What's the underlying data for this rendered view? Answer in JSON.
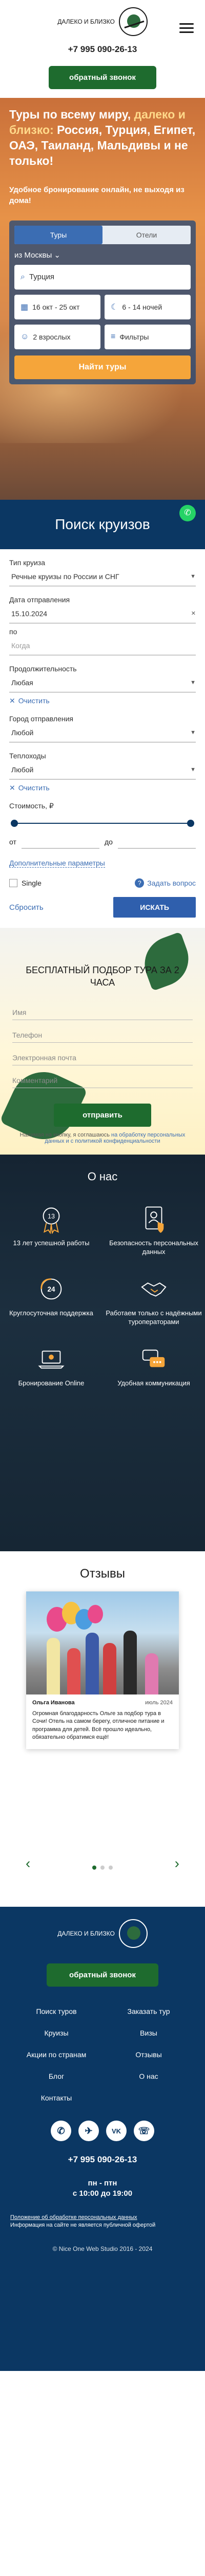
{
  "header": {
    "logo_text": "ДАЛЕКО И БЛИЗКО",
    "phone": "+7 995 090-26-13",
    "callback_btn": "обратный звонок"
  },
  "hero": {
    "title_a": "Туры по всему миру, ",
    "title_hi": "далеко и близко:",
    "title_b": " Россия, Турция, Египет, ОАЭ, Таиланд, Мальдивы и не только!",
    "subtitle": "Удобное бронирование онлайн, не выходя из дома!",
    "tabs": [
      "Туры",
      "Отели"
    ],
    "from_label": "из Москвы",
    "destination": "Турция",
    "dates": "16 окт - 25 окт",
    "nights": "6 - 14 ночей",
    "tourists": "2 взрослых",
    "filters": "Фильтры",
    "find_btn": "Найти туры"
  },
  "cruise": {
    "title": "Поиск круизов",
    "type_label": "Тип круиза",
    "type_value": "Речные круизы по России и СНГ",
    "date_label": "Дата отправления",
    "date_value": "15.10.2024",
    "to_label": "по",
    "to_placeholder": "Когда",
    "duration_label": "Продолжительность",
    "duration_value": "Любая",
    "clear": "Очистить",
    "city_label": "Город отправления",
    "city_value": "Любой",
    "ship_label": "Теплоходы",
    "ship_value": "Любой",
    "price_label": "Стоимость, ₽",
    "from": "от",
    "to": "до",
    "advanced": "Дополнительные параметры",
    "single": "Single",
    "help": "Задать вопрос",
    "reset": "Сбросить",
    "search_btn": "ИСКАТЬ"
  },
  "callback": {
    "title": "БЕСПЛАТНЫЙ ПОДБОР ТУРА ЗА 2 ЧАСА",
    "fields": [
      "Имя",
      "Телефон",
      "Электронная почта",
      "Комментарий"
    ],
    "send_btn": "отправить",
    "consent_a": "Нажимая на кнопку, я соглашаюсь ",
    "consent_link": "на обработку персональных данных и с политикой конфиденциальности"
  },
  "about": {
    "title": "О нас",
    "features": [
      {
        "text": "13 лет успешной работы",
        "icon": "ribbon-icon"
      },
      {
        "text": "Безопасность персональных данных",
        "icon": "shield-person-icon"
      },
      {
        "text": "Круглосуточная поддержка",
        "icon": "support-24-icon"
      },
      {
        "text": "Работаем только с надёжными туроператорами",
        "icon": "handshake-icon"
      },
      {
        "text": "Бронирование Online",
        "icon": "laptop-icon"
      },
      {
        "text": "Удобная коммуникация",
        "icon": "chat-icon"
      }
    ]
  },
  "reviews": {
    "title": "Отзывы",
    "name": "Ольга Иванова",
    "date": "июль 2024",
    "text": "Огромная благодарность Ольге за подбор тура в Сочи! Отель на самом берегу, отличное питание и программа для детей. Всё прошло идеально, обязательно обратимся ещё!"
  },
  "footer": {
    "logo_text": "ДАЛЕКО И БЛИЗКО",
    "callback_btn": "обратный звонок",
    "menu": [
      "Поиск туров",
      "Заказать тур",
      "Круизы",
      "Визы",
      "Акции по странам",
      "Отзывы",
      "Блог",
      "О нас",
      "Контакты",
      ""
    ],
    "social": [
      "✆",
      "✈",
      "VK",
      "☏"
    ],
    "phone": "+7 995 090-26-13",
    "days": "пн - птн",
    "hours": "с 10:00 до 19:00",
    "note1": "Положение об обработке персональных данных",
    "note2": "Информация на сайте не является публичной офертой",
    "copyright": "© Nice One Web Studio 2016 - 2024"
  }
}
